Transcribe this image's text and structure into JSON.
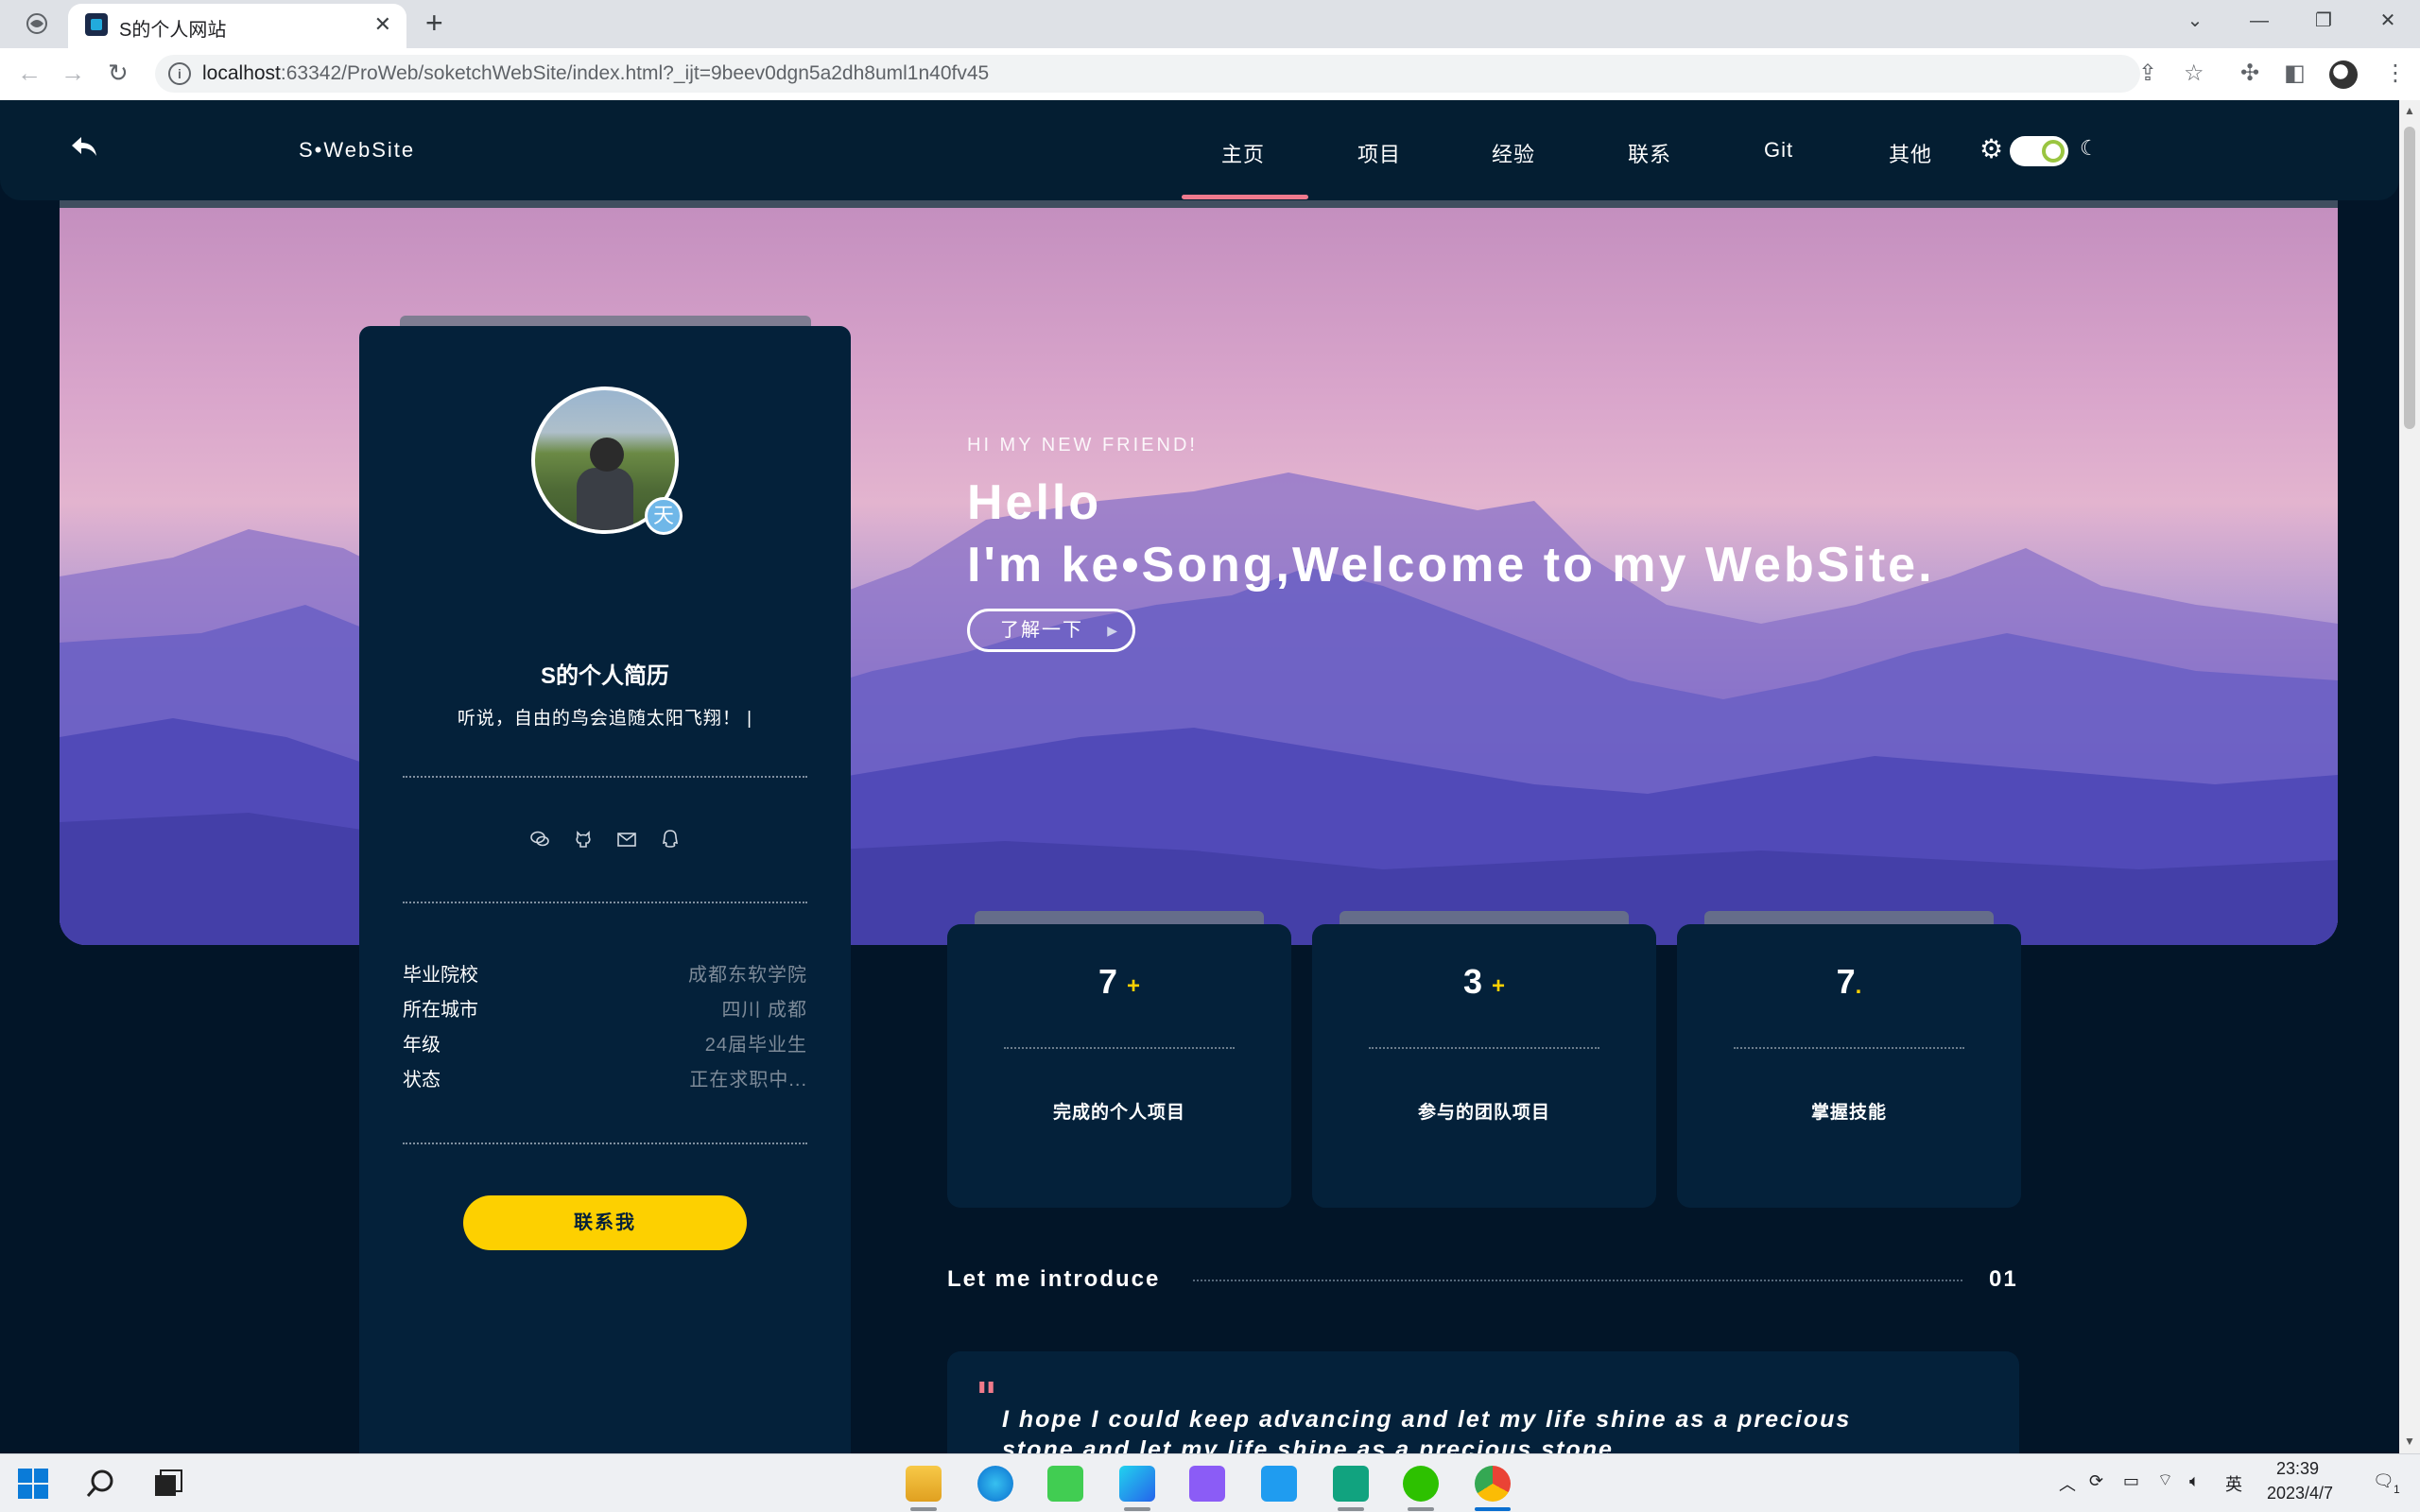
{
  "browser": {
    "tab_title": "S的个人网站",
    "url_host": "localhost",
    "url_rest": ":63342/ProWeb/soketchWebSite/index.html?_ijt=9beev0dgn5a2dh8uml1n40fv45"
  },
  "site": {
    "brand": "S•WebSite",
    "menu": [
      "主页",
      "项目",
      "经验",
      "联系",
      "Git",
      "其他"
    ],
    "active_menu": "主页"
  },
  "hero": {
    "kicker": "HI MY NEW FRIEND!",
    "hello": "Hello",
    "welcome": "I'm ke•Song,Welcome to my WebSite.",
    "button": "了解一下"
  },
  "profile": {
    "name": "S的个人简历",
    "motto": "听说，自由的鸟会追随太阳飞翔！",
    "badge": "天",
    "info": [
      {
        "key": "毕业院校",
        "value": "成都东软学院"
      },
      {
        "key": "所在城市",
        "value": "四川 成都"
      },
      {
        "key": "年级",
        "value": "24届毕业生"
      },
      {
        "key": "状态",
        "value": "正在求职中..."
      }
    ],
    "contact_button": "联系我"
  },
  "stats": [
    {
      "number": "7",
      "suffix": "+",
      "label": "完成的个人项目"
    },
    {
      "number": "3",
      "suffix": "+",
      "label": "参与的团队项目"
    },
    {
      "number": "7",
      "suffix": ".",
      "label": "掌握技能"
    }
  ],
  "intro": {
    "title": "Let me introduce",
    "number": "01",
    "quote": "I hope I could keep advancing and let my life shine as a precious stone.and let my life shine as a precious stone.",
    "quote_open": "\"",
    "quote_close": "\""
  },
  "taskbar": {
    "time": "23:39",
    "date": "2023/4/7",
    "ime": "英",
    "notif_count": "1"
  },
  "colors": {
    "page_bg": "#021528",
    "card_bg": "#04213a",
    "accent_yellow": "#fdd000",
    "accent_pink": "#f07a8a"
  }
}
